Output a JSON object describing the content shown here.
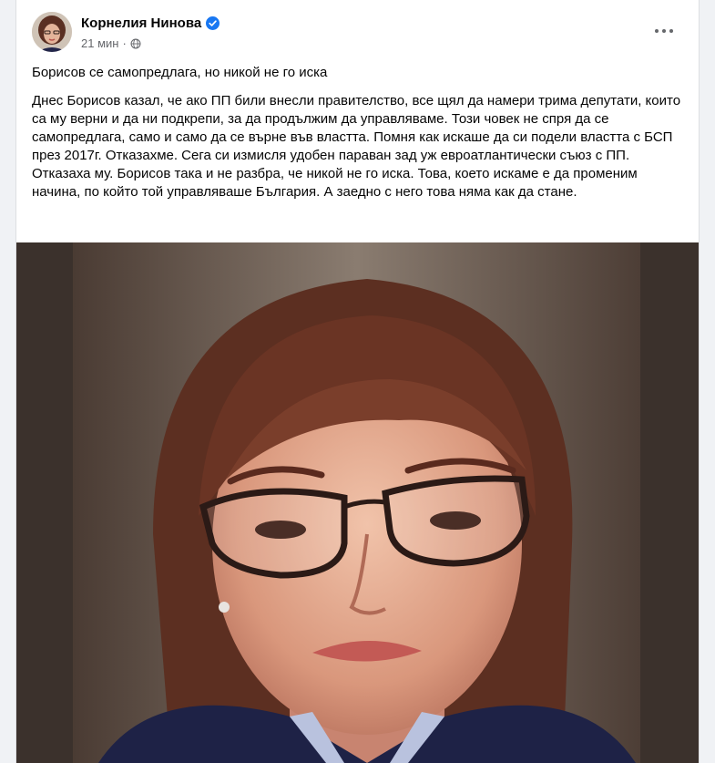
{
  "post": {
    "author": "Корнелия Нинова",
    "time": "21 мин",
    "privacy_icon": "globe-icon",
    "verified_icon": "verified-badge-icon",
    "more_icon": "more-options-icon",
    "title_line": "Борисов се самопредлага, но никой не го иска",
    "body": "Днес Борисов казал, че ако ПП били внесли правителство, все щял да намери трима депутати, които са му верни и да ни подкрепи, за да продължим да управляваме.  Този човек не спря да се самопредлага, само и само да се върне във властта. Помня как искаше да си подели властта  с БСП през 2017г. Отказахме. Сега си измисля удобен параван зад уж евроатлантически съюз с ПП. Отказаха му. Борисов така и не разбра, че никой не го иска. Това, което искаме е да променим начина, по който той управляваше България. А заедно с него това няма как да стане."
  },
  "colors": {
    "accent": "#1877f2",
    "meta_text": "#65676b",
    "photo_bg": "#3b312c"
  }
}
